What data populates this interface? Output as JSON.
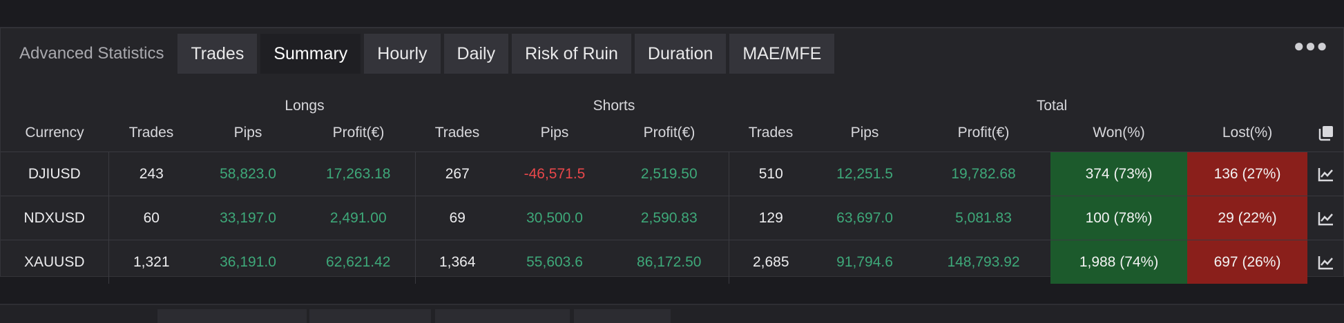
{
  "panel": {
    "title": "Advanced Statistics",
    "tabs": [
      {
        "label": "Trades",
        "active": false
      },
      {
        "label": "Summary",
        "active": true
      },
      {
        "label": "Hourly",
        "active": false
      },
      {
        "label": "Daily",
        "active": false
      },
      {
        "label": "Risk of Ruin",
        "active": false
      },
      {
        "label": "Duration",
        "active": false
      },
      {
        "label": "MAE/MFE",
        "active": false
      }
    ],
    "more_icon": "ellipsis-icon"
  },
  "table": {
    "groups": {
      "longs": "Longs",
      "shorts": "Shorts",
      "total": "Total"
    },
    "headers": {
      "currency": "Currency",
      "long_trades": "Trades",
      "long_pips": "Pips",
      "long_profit": "Profit(€)",
      "short_trades": "Trades",
      "short_pips": "Pips",
      "short_profit": "Profit(€)",
      "total_trades": "Trades",
      "total_pips": "Pips",
      "total_profit": "Profit(€)",
      "won": "Won(%)",
      "lost": "Lost(%)"
    },
    "rows": [
      {
        "currency": "DJIUSD",
        "long_trades": "243",
        "long_pips": "58,823.0",
        "long_profit": "17,263.18",
        "short_trades": "267",
        "short_pips": "-46,571.5",
        "short_profit": "2,519.50",
        "total_trades": "510",
        "total_pips": "12,251.5",
        "total_profit": "19,782.68",
        "won": "374 (73%)",
        "lost": "136 (27%)"
      },
      {
        "currency": "NDXUSD",
        "long_trades": "60",
        "long_pips": "33,197.0",
        "long_profit": "2,491.00",
        "short_trades": "69",
        "short_pips": "30,500.0",
        "short_profit": "2,590.83",
        "total_trades": "129",
        "total_pips": "63,697.0",
        "total_profit": "5,081.83",
        "won": "100 (78%)",
        "lost": "29 (22%)"
      },
      {
        "currency": "XAUUSD",
        "long_trades": "1,321",
        "long_pips": "36,191.0",
        "long_profit": "62,621.42",
        "short_trades": "1,364",
        "short_pips": "55,603.6",
        "short_profit": "86,172.50",
        "total_trades": "2,685",
        "total_pips": "91,794.6",
        "total_profit": "148,793.92",
        "won": "1,988 (74%)",
        "lost": "697 (26%)"
      }
    ]
  },
  "colors": {
    "positive": "#3ea879",
    "negative": "#e8474a",
    "won_bg": "#1c5a2c",
    "lost_bg": "#8a1f1b"
  },
  "icons": {
    "copy": "copy-icon",
    "row_chart": "chart-icon"
  }
}
